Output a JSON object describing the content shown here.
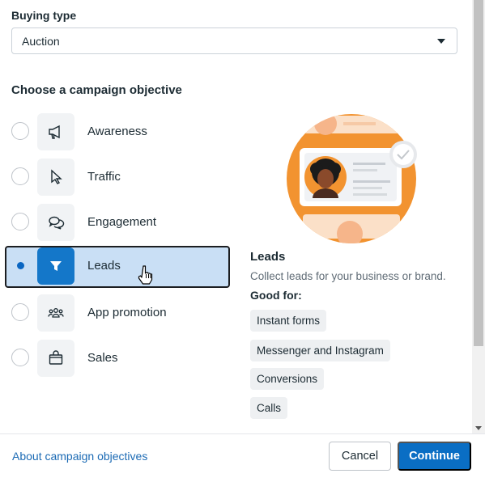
{
  "buying_type": {
    "label": "Buying type",
    "selected": "Auction"
  },
  "objective_heading": "Choose a campaign objective",
  "objectives": [
    {
      "label": "Awareness",
      "icon": "megaphone-icon",
      "selected": false
    },
    {
      "label": "Traffic",
      "icon": "cursor-icon",
      "selected": false
    },
    {
      "label": "Engagement",
      "icon": "chat-bubbles-icon",
      "selected": false
    },
    {
      "label": "Leads",
      "icon": "funnel-icon",
      "selected": true
    },
    {
      "label": "App promotion",
      "icon": "people-icon",
      "selected": false
    },
    {
      "label": "Sales",
      "icon": "shopping-bag-icon",
      "selected": false
    }
  ],
  "detail": {
    "title": "Leads",
    "description": "Collect leads for your business or brand.",
    "good_for_label": "Good for:",
    "good_for": [
      "Instant forms",
      "Messenger and Instagram",
      "Conversions",
      "Calls"
    ]
  },
  "footer": {
    "link": "About campaign objectives",
    "cancel": "Cancel",
    "continue": "Continue"
  },
  "colors": {
    "accent": "#0a6ec4",
    "selected_bg": "#c9dff5",
    "illustration_orange": "#f29330"
  }
}
